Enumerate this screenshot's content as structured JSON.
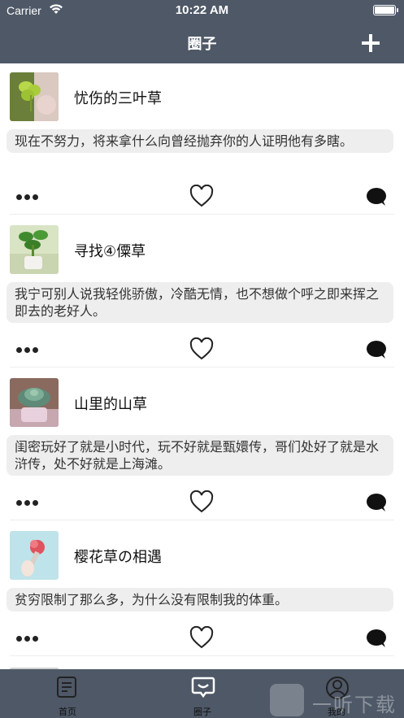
{
  "status_bar": {
    "carrier": "Carrier",
    "time": "10:22 AM"
  },
  "header": {
    "title": "圈子",
    "add_icon": "plus-icon"
  },
  "posts": [
    {
      "title": "忧伤的三叶草",
      "content": "现在不努力，将来拿什么向曾经抛弃你的人证明他有多瞎。",
      "avatar": "clover-photo"
    },
    {
      "title": "寻找④僳草",
      "content": "我宁可别人说我轻佻骄傲，冷酷无情，也不想做个呼之即来挥之即去的老好人。",
      "avatar": "potted-plant-photo"
    },
    {
      "title": "山里的山草",
      "content": "闺密玩好了就是小时代，玩不好就是甄嬛传，哥们处好了就是水浒传，处不好就是上海滩。",
      "avatar": "succulent-photo"
    },
    {
      "title": "樱花草の相遇",
      "content": "贫穷限制了那么多，为什么没有限制我的体重。",
      "avatar": "flower-photo"
    }
  ],
  "tabs": [
    {
      "label": "首页",
      "icon": "document-icon"
    },
    {
      "label": "圈子",
      "icon": "chat-bubble-icon"
    },
    {
      "label": "我的",
      "icon": "user-icon"
    }
  ],
  "watermark": {
    "text": "一听下载",
    "logo_char": "听"
  },
  "colors": {
    "bar_background": "#4e5867",
    "bubble_background": "#eeeeee"
  }
}
